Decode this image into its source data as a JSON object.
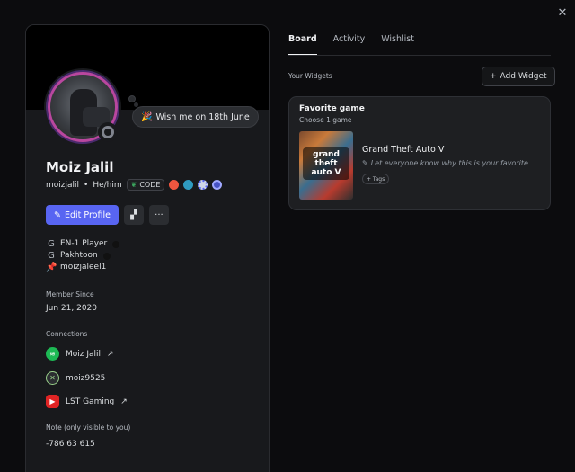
{
  "window": {
    "close_label": "✕"
  },
  "profile": {
    "display_name": "Moiz Jalil",
    "username": "moizjalil",
    "separator": "•",
    "pronouns": "He/him",
    "custom_status": "Wish me on 18th June",
    "status_emoji": "🎉",
    "server_tag": "CODE",
    "edit_profile_label": "Edit Profile",
    "more_label": "···",
    "roles": [
      {
        "icon": "G",
        "label": "EN-1 Player"
      },
      {
        "icon": "G",
        "label": "Pakhtoon"
      },
      {
        "icon": "📌",
        "label": "moizjaleel1"
      }
    ],
    "member_since_label": "Member Since",
    "member_since": "Jun 21, 2020",
    "connections_label": "Connections",
    "connections": [
      {
        "service": "spotify",
        "name": "Moiz Jalil",
        "external": "↗"
      },
      {
        "service": "xbox",
        "name": "moiz9525",
        "external": ""
      },
      {
        "service": "youtube",
        "name": "LST Gaming",
        "external": "↗"
      }
    ],
    "note_label": "Note (only visible to you)",
    "note": "-786 63 615"
  },
  "tabs": [
    "Board",
    "Activity",
    "Wishlist"
  ],
  "widgets_section": {
    "label": "Your Widgets",
    "add_label": "Add Widget",
    "widget": {
      "title": "Favorite game",
      "subtitle": "Choose 1 game",
      "game_title": "Grand Theft Auto V",
      "note": "Let everyone know why this is your favorite",
      "tags_label": "+ Tags",
      "cover_text": "grand theft auto V"
    }
  },
  "colors": {
    "accent": "#5865f2",
    "avatar_ring": "#b9479f",
    "background": "#0c0c0e",
    "card": "#18191c"
  }
}
